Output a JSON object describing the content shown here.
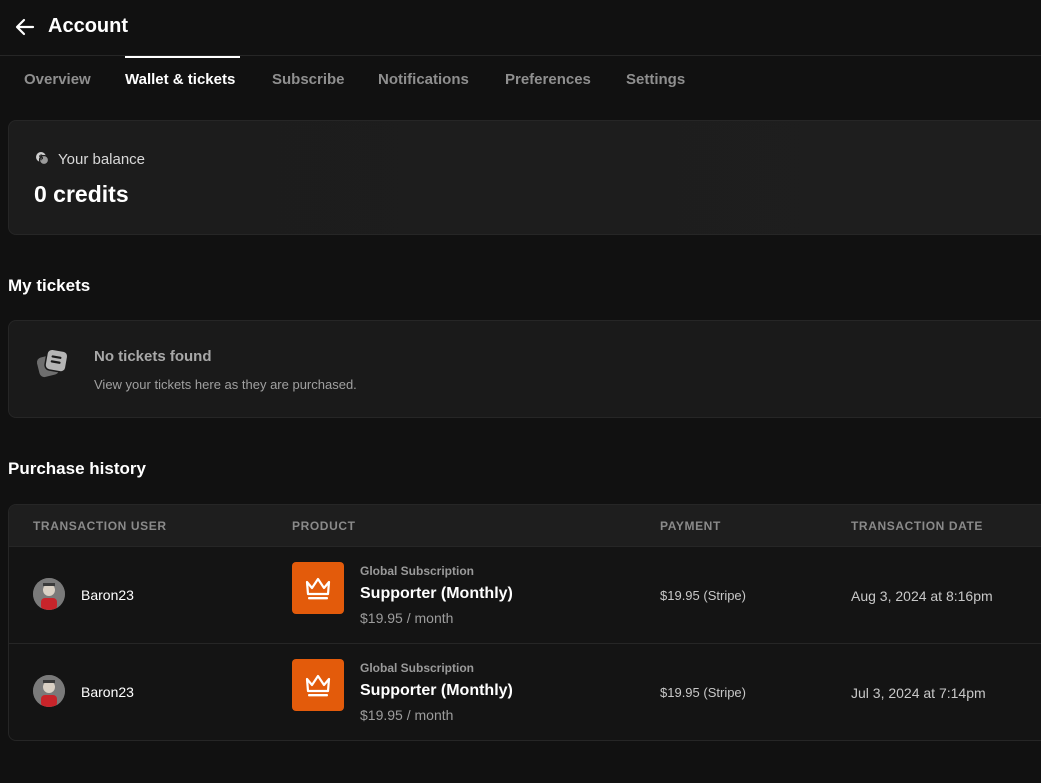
{
  "header": {
    "back_icon": "arrow-left-icon",
    "title": "Account"
  },
  "tabs": [
    {
      "label": "Overview",
      "active": false
    },
    {
      "label": "Wallet & tickets",
      "active": true
    },
    {
      "label": "Subscribe",
      "active": false
    },
    {
      "label": "Notifications",
      "active": false
    },
    {
      "label": "Preferences",
      "active": false
    },
    {
      "label": "Settings",
      "active": false
    }
  ],
  "balance": {
    "icon": "coin-icon",
    "label": "Your balance",
    "value": "0 credits"
  },
  "tickets": {
    "title": "My tickets",
    "icon": "ticket-icon",
    "empty_title": "No tickets found",
    "empty_description": "View your tickets here as they are purchased."
  },
  "purchase_history": {
    "title": "Purchase history",
    "columns": [
      "TRANSACTION USER",
      "PRODUCT",
      "PAYMENT",
      "TRANSACTION DATE"
    ],
    "rows": [
      {
        "user": "Baron23",
        "product_category": "Global Subscription",
        "product_name": "Supporter (Monthly)",
        "product_price": "$19.95 / month",
        "payment": "$19.95 (Stripe)",
        "date": "Aug 3, 2024 at 8:16pm"
      },
      {
        "user": "Baron23",
        "product_category": "Global Subscription",
        "product_name": "Supporter (Monthly)",
        "product_price": "$19.95 / month",
        "payment": "$19.95 (Stripe)",
        "date": "Jul 3, 2024 at 7:14pm"
      }
    ]
  },
  "colors": {
    "background": "#111111",
    "product_accent": "#e35b0b",
    "text_primary": "#ffffff",
    "text_muted": "#8f8f8f"
  }
}
